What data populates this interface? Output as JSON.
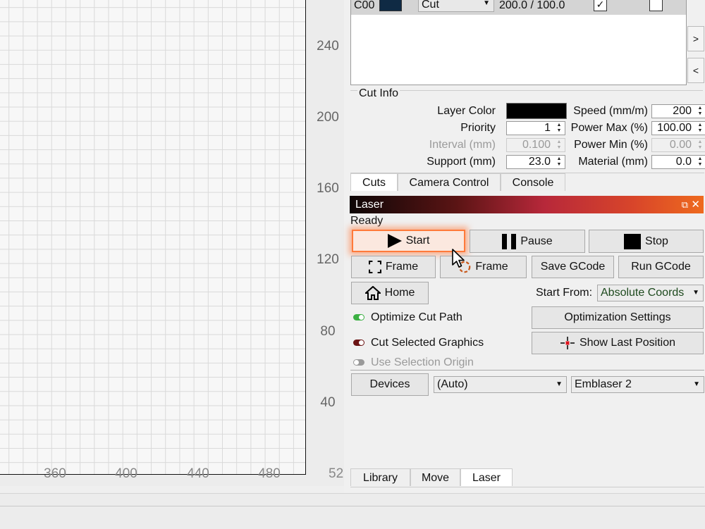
{
  "canvas": {
    "ruler_y": [
      "240",
      "200",
      "160",
      "120",
      "80",
      "40"
    ],
    "ruler_x": [
      "360",
      "400",
      "440",
      "480"
    ],
    "ruler_corner": "52"
  },
  "layers": {
    "row": {
      "name": "C00",
      "color": "#0f2a44",
      "mode": "Cut",
      "speed_power": "200.0 / 100.0",
      "output": true,
      "air": false
    }
  },
  "cut_info": {
    "legend": "Cut Info",
    "layer_color_label": "Layer Color",
    "layer_color": "#000000",
    "priority_label": "Priority",
    "priority": "1",
    "interval_label": "Interval (mm)",
    "interval": "0.100",
    "support_label": "Support (mm)",
    "support": "23.0",
    "speed_label": "Speed (mm/m)",
    "speed": "200",
    "power_max_label": "Power Max (%)",
    "power_max": "100.00",
    "power_min_label": "Power Min (%)",
    "power_min": "0.00",
    "material_label": "Material (mm)",
    "material": "0.0"
  },
  "top_tabs": [
    "Cuts",
    "Camera Control",
    "Console"
  ],
  "laser": {
    "title": "Laser",
    "status": "Ready",
    "start": "Start",
    "pause": "Pause",
    "stop": "Stop",
    "frame1": "Frame",
    "frame2": "Frame",
    "save_gcode": "Save GCode",
    "run_gcode": "Run GCode",
    "home": "Home",
    "start_from_label": "Start From:",
    "start_from_value": "Absolute Coords",
    "optimize_cut_path": "Optimize Cut Path",
    "cut_selected_graphics": "Cut Selected Graphics",
    "use_selection_origin": "Use Selection Origin",
    "optimization_settings": "Optimization Settings",
    "show_last_position": "Show Last Position",
    "devices": "Devices",
    "port": "(Auto)",
    "device": "Emblaser 2"
  },
  "bottom_tabs": [
    "Library",
    "Move",
    "Laser"
  ],
  "colors": {
    "toggle_on": "#3cb043",
    "toggle_cut_selected": "#6b1414",
    "toggle_off": "#9a9a9a",
    "start_glow": "#ff7a3a"
  }
}
